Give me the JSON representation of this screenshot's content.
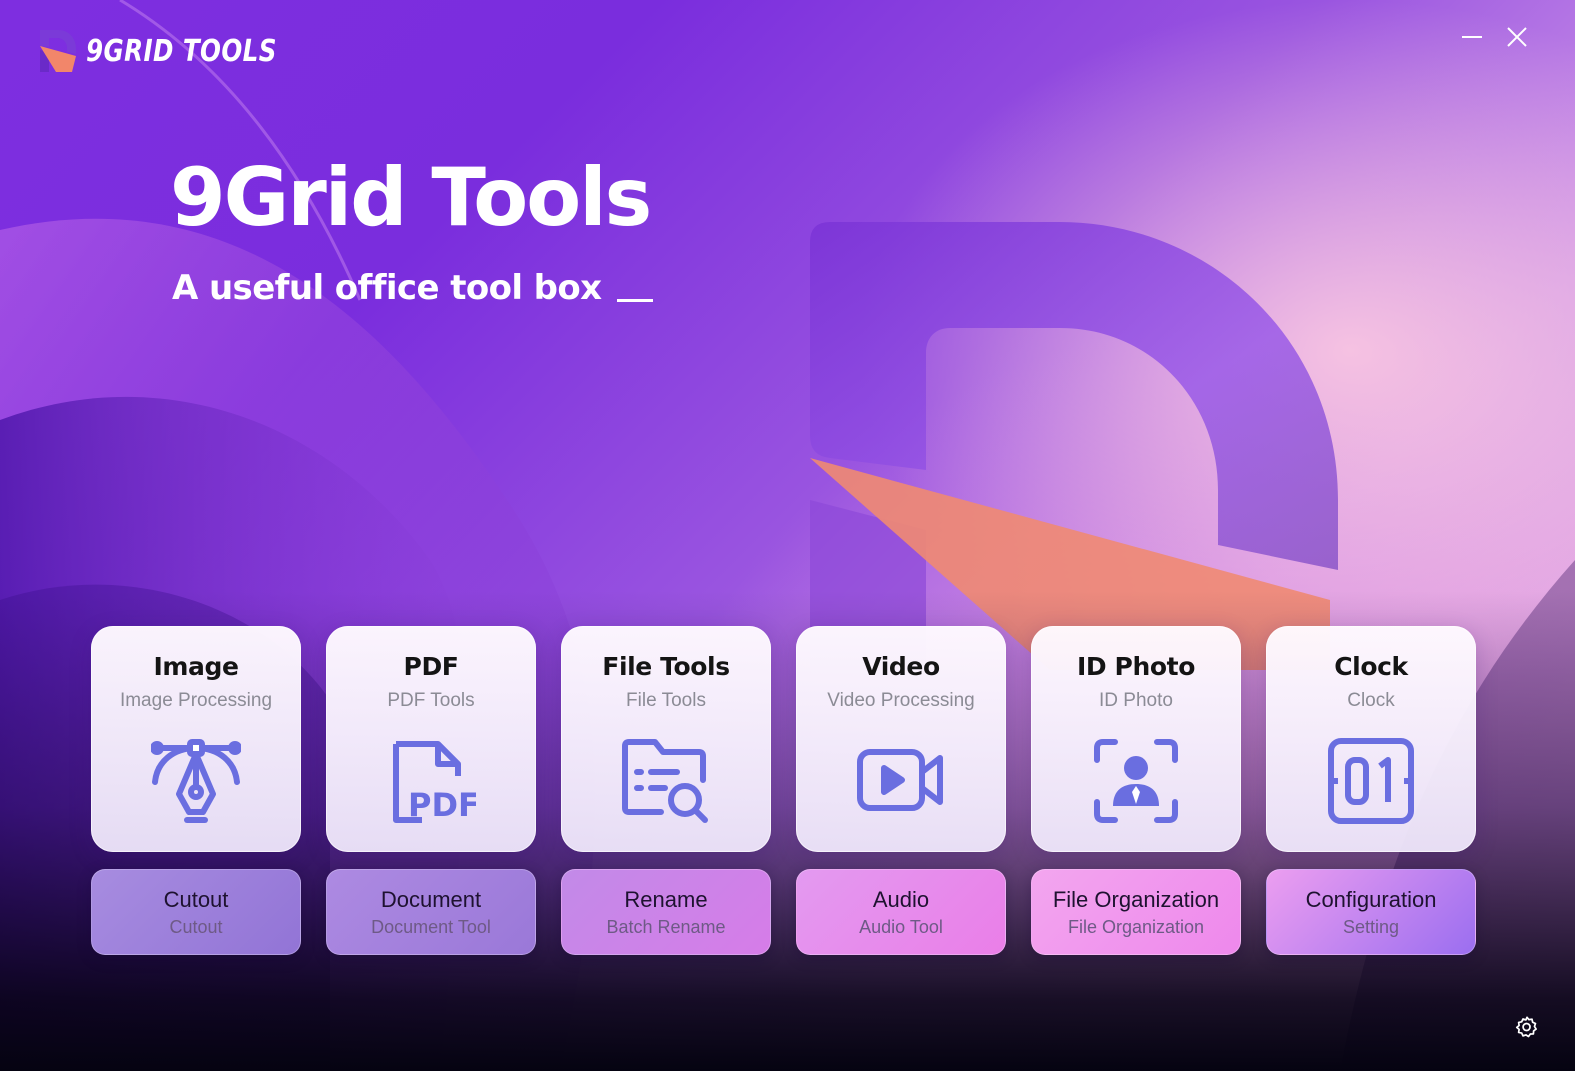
{
  "app": {
    "brand_name": "9GRID TOOLS",
    "title": "9Grid Tools",
    "subtitle": "A useful office tool box"
  },
  "colors": {
    "accent": "#6a6ee0",
    "brand_purple": "#7b3ad8",
    "brand_orange": "#f2866a"
  },
  "window_controls": {
    "minimize_icon": "minimize-icon",
    "close_icon": "close-icon"
  },
  "cards": [
    {
      "title": "Image",
      "subtitle": "Image Processing",
      "icon": "pen-tool-icon"
    },
    {
      "title": "PDF",
      "subtitle": "PDF Tools",
      "icon": "pdf-file-icon"
    },
    {
      "title": "File Tools",
      "subtitle": "File Tools",
      "icon": "file-search-icon"
    },
    {
      "title": "Video",
      "subtitle": "Video Processing",
      "icon": "video-camera-icon"
    },
    {
      "title": "ID Photo",
      "subtitle": "ID Photo",
      "icon": "id-photo-icon"
    },
    {
      "title": "Clock",
      "subtitle": "Clock",
      "icon": "clock-digital-icon"
    }
  ],
  "sub_tools": [
    {
      "title": "Cutout",
      "subtitle": "Cutout"
    },
    {
      "title": "Document",
      "subtitle": "Document Tool"
    },
    {
      "title": "Rename",
      "subtitle": "Batch Rename"
    },
    {
      "title": "Audio",
      "subtitle": "Audio Tool"
    },
    {
      "title": "File Organization",
      "subtitle": "File Organization"
    },
    {
      "title": "Configuration",
      "subtitle": "Setting"
    }
  ],
  "footer": {
    "settings_icon": "gear-icon"
  }
}
